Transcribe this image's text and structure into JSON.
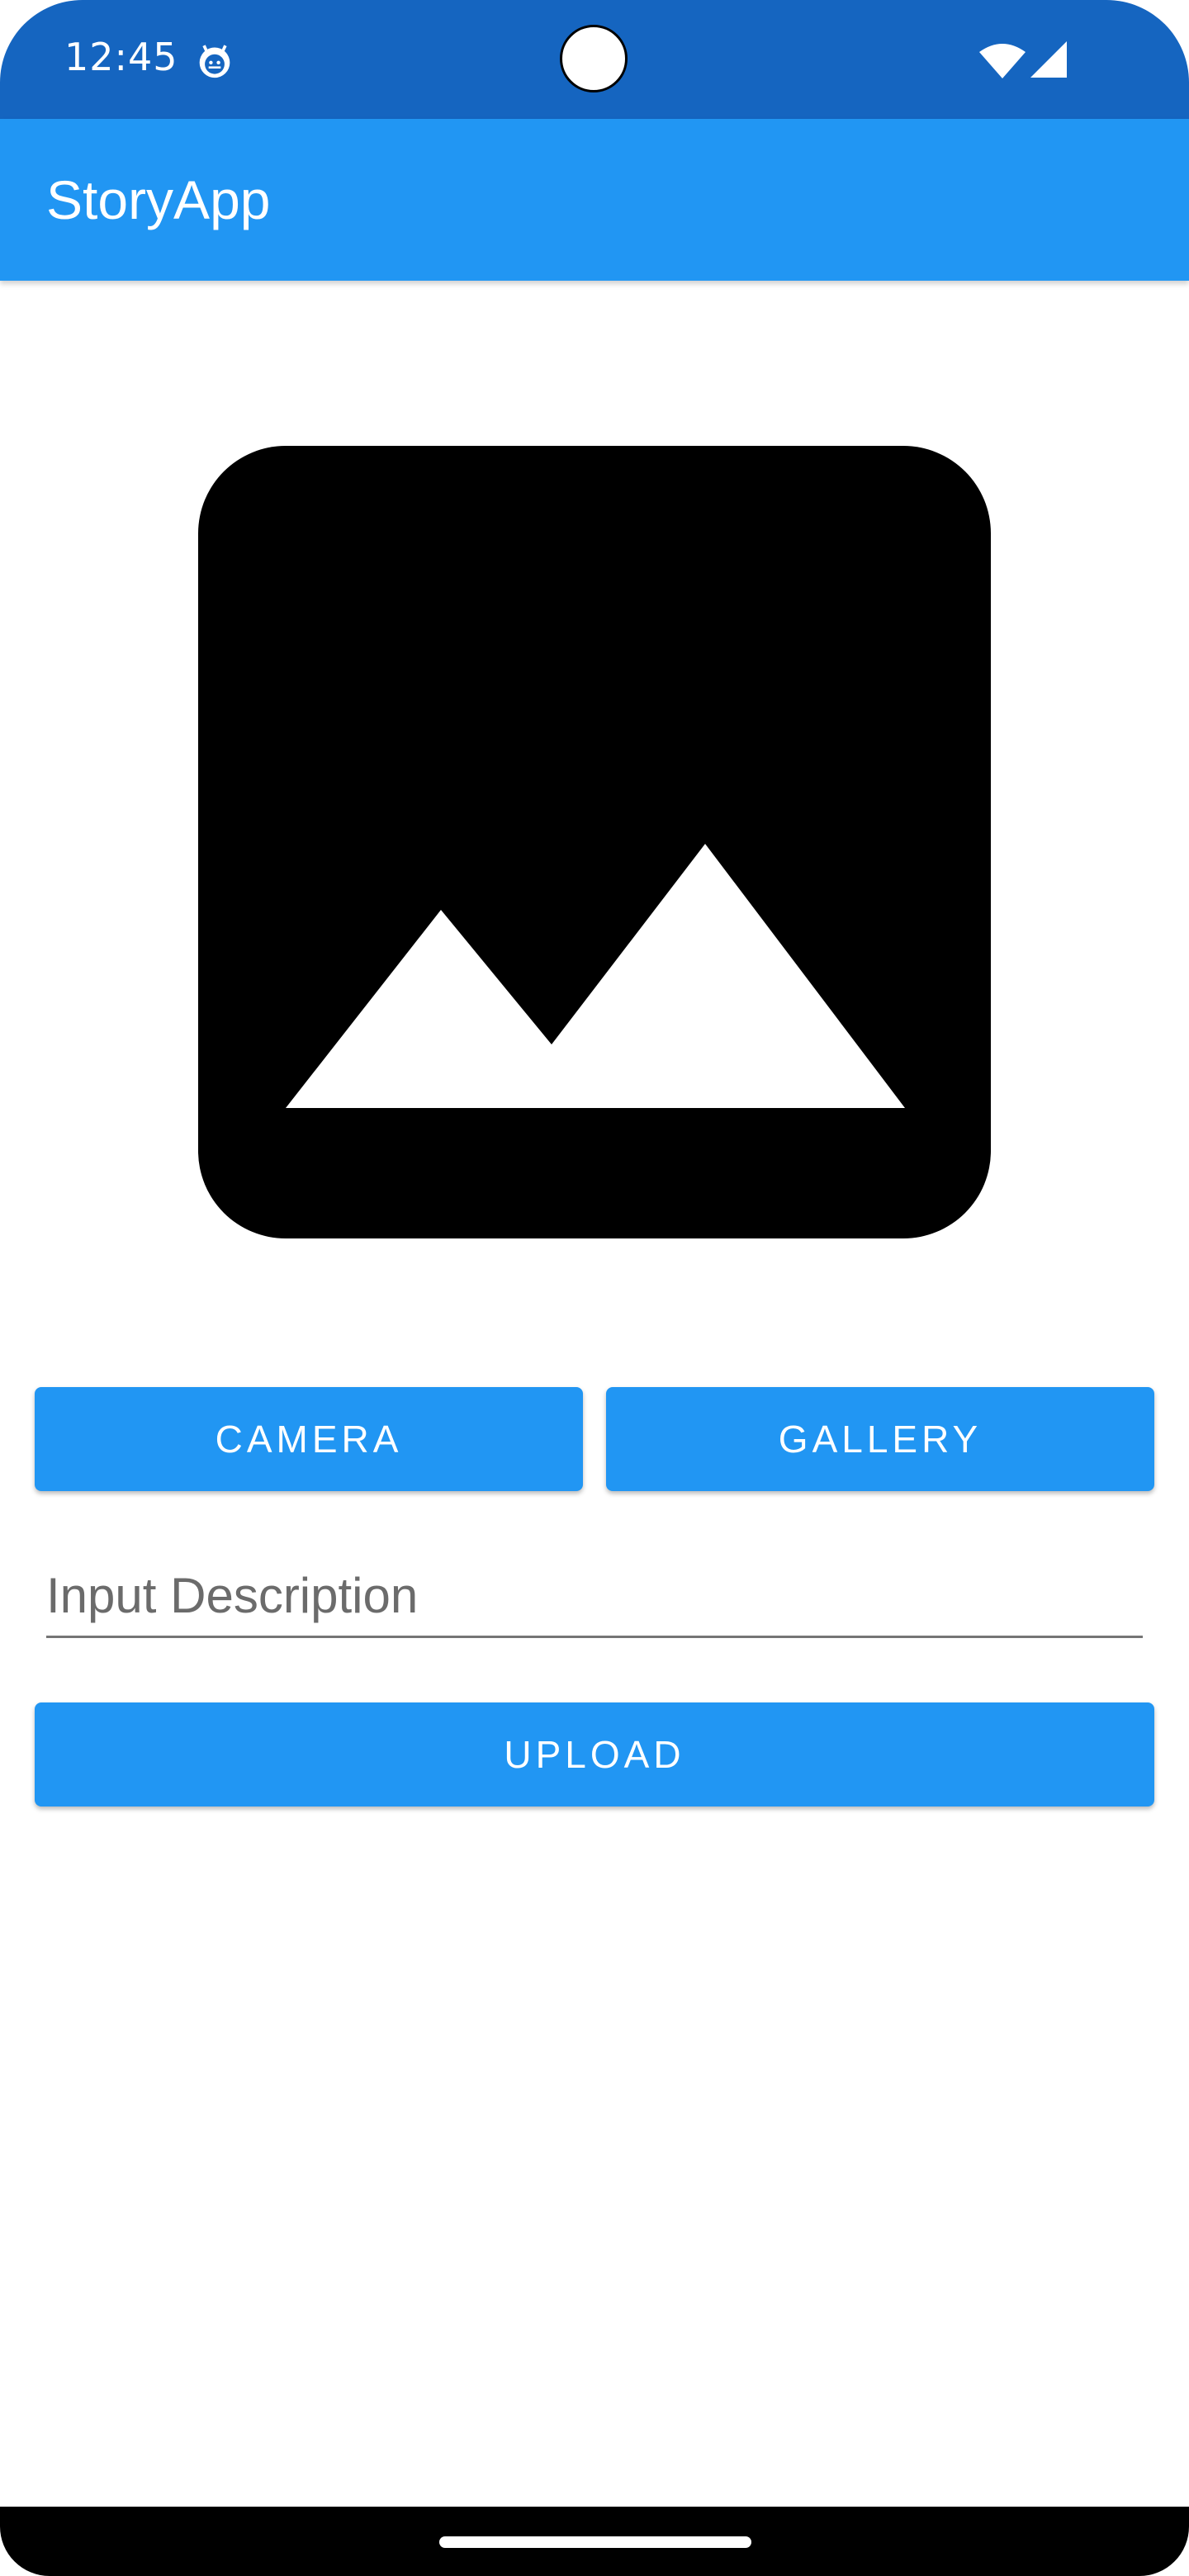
{
  "status_bar": {
    "time": "12:45",
    "app_icon": "android-debug-icon",
    "wifi_icon": "wifi-icon",
    "signal_icon": "cell-signal-icon",
    "background": "#1565C0"
  },
  "app_bar": {
    "title": "StoryApp",
    "background": "#2196F3"
  },
  "preview": {
    "icon": "image-placeholder-icon"
  },
  "buttons": {
    "camera_label": "CAMERA",
    "gallery_label": "GALLERY",
    "upload_label": "UPLOAD",
    "color": "#2196F3"
  },
  "description": {
    "placeholder": "Input Description",
    "value": ""
  }
}
